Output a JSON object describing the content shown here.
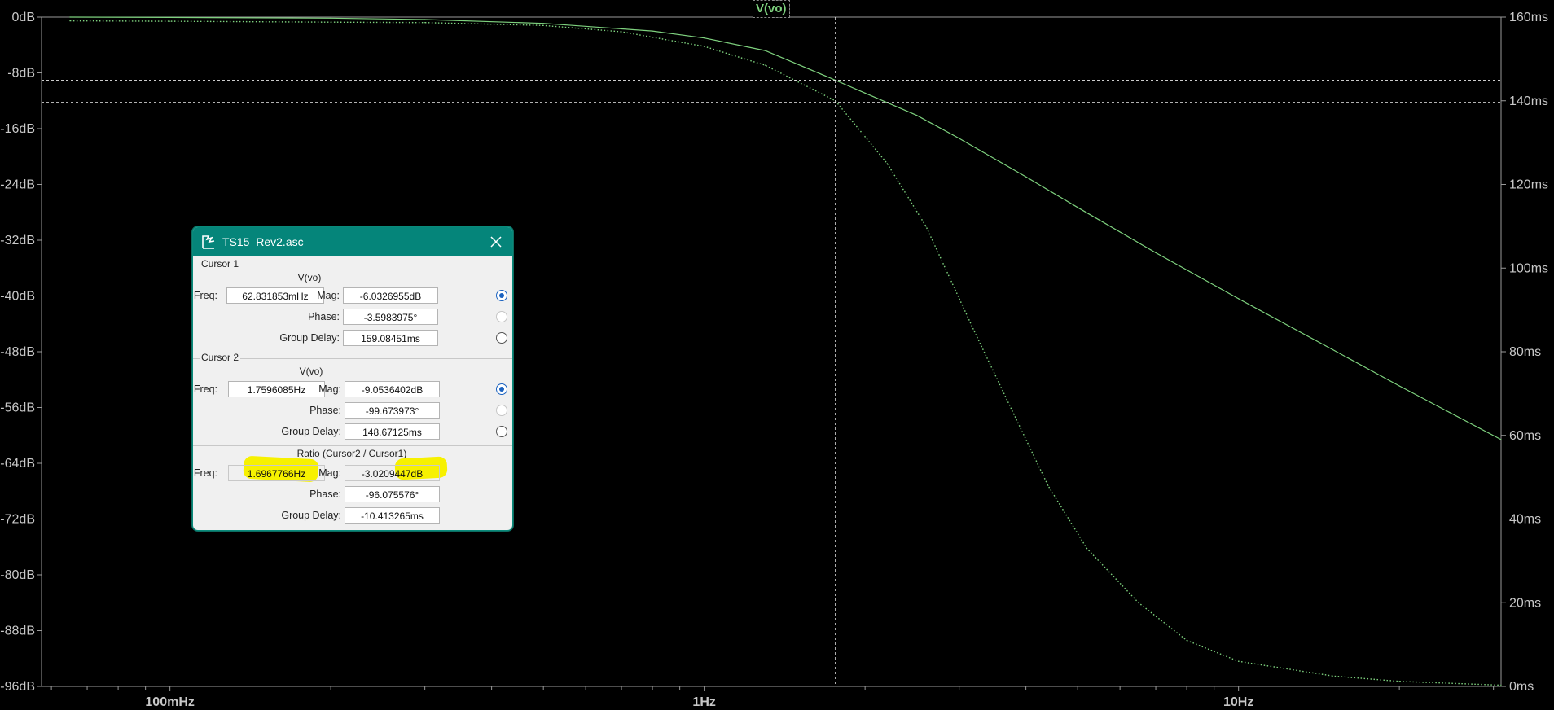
{
  "chart_data": {
    "type": "line",
    "title": "",
    "trace_label": "V(vo)",
    "x_scale": "log",
    "xlim_hz": [
      0.0575,
      31.0
    ],
    "x_ticks": [
      {
        "value": 0.1,
        "label": "100mHz"
      },
      {
        "value": 1,
        "label": "1Hz"
      },
      {
        "value": 10,
        "label": "10Hz"
      }
    ],
    "left_axis": {
      "unit": "dB",
      "ylim": [
        -96,
        0
      ],
      "ticks": [
        "0dB",
        "-8dB",
        "-16dB",
        "-24dB",
        "-32dB",
        "-40dB",
        "-48dB",
        "-56dB",
        "-64dB",
        "-72dB",
        "-80dB",
        "-88dB",
        "-96dB"
      ]
    },
    "right_axis": {
      "unit": "ms",
      "ylim": [
        0,
        160
      ],
      "ticks": [
        "160ms",
        "140ms",
        "120ms",
        "100ms",
        "80ms",
        "60ms",
        "40ms",
        "20ms",
        "0ms"
      ]
    },
    "cursor": {
      "freq_hz": 1.7596085,
      "mag_db": -9.0536402
    },
    "series": [
      {
        "role": "magnitude",
        "axis": "left",
        "style": "solid",
        "points": [
          [
            0.065,
            0
          ],
          [
            0.1,
            -0.05
          ],
          [
            0.2,
            -0.15
          ],
          [
            0.3,
            -0.35
          ],
          [
            0.5,
            -0.9
          ],
          [
            0.8,
            -2.0
          ],
          [
            1.0,
            -3.0
          ],
          [
            1.3,
            -4.8
          ],
          [
            1.7596,
            -9.05
          ],
          [
            2.0,
            -10.9
          ],
          [
            2.5,
            -14.1
          ],
          [
            3.0,
            -17.4
          ],
          [
            4.0,
            -22.9
          ],
          [
            5.0,
            -27.3
          ],
          [
            7.0,
            -33.8
          ],
          [
            10.0,
            -40.4
          ],
          [
            15.0,
            -47.7
          ],
          [
            20.0,
            -52.9
          ],
          [
            31.0,
            -60.6
          ]
        ]
      },
      {
        "role": "group_delay",
        "axis": "right",
        "style": "dotted",
        "points": [
          [
            0.065,
            159.1
          ],
          [
            0.1,
            159.0
          ],
          [
            0.2,
            158.8
          ],
          [
            0.3,
            158.7
          ],
          [
            0.5,
            158.0
          ],
          [
            0.7,
            156.5
          ],
          [
            1.0,
            153.0
          ],
          [
            1.3,
            148.5
          ],
          [
            1.7596,
            140.0
          ],
          [
            2.2,
            125.0
          ],
          [
            2.6,
            110.0
          ],
          [
            3.2,
            85.0
          ],
          [
            3.8,
            65.0
          ],
          [
            4.4,
            48.0
          ],
          [
            5.2,
            33.0
          ],
          [
            6.5,
            20.0
          ],
          [
            8.0,
            11.0
          ],
          [
            10.0,
            6.0
          ],
          [
            15.0,
            2.5
          ],
          [
            20.0,
            1.2
          ],
          [
            31.0,
            0.3
          ]
        ]
      }
    ],
    "colors": {
      "trace": "#7ed17e",
      "axis": "#9a9a9a",
      "background": "#000000",
      "cursor_line": "#ffffff"
    }
  },
  "dialog": {
    "title": "TS15_Rev2.asc",
    "cursor1": {
      "section_label": "Cursor 1",
      "expr": "V(vo)",
      "freq_label": "Freq:",
      "freq": "62.831853mHz",
      "mag_label": "Mag:",
      "mag": "-6.0326955dB",
      "phase_label": "Phase:",
      "phase": "-3.5983975°",
      "gd_label": "Group Delay:",
      "gd": "159.08451ms"
    },
    "cursor2": {
      "section_label": "Cursor 2",
      "expr": "V(vo)",
      "freq_label": "Freq:",
      "freq": "1.7596085Hz",
      "mag_label": "Mag:",
      "mag": "-9.0536402dB",
      "phase_label": "Phase:",
      "phase": "-99.673973°",
      "gd_label": "Group Delay:",
      "gd": "148.67125ms"
    },
    "ratio": {
      "section_label": "Ratio (Cursor2 / Cursor1)",
      "freq_label": "Freq:",
      "freq": "1.6967766Hz",
      "mag_label": "Mag:",
      "mag": "-3.0209447dB",
      "phase_label": "Phase:",
      "phase": "-96.075576°",
      "gd_label": "Group Delay:",
      "gd": "-10.413265ms"
    },
    "radio_states": {
      "c1_mag": true,
      "c1_phase": false,
      "c1_gd": false,
      "c2_mag": true,
      "c2_phase": false,
      "c2_gd": false
    },
    "accent_color": "#05857a",
    "highlight_color": "#f7f100"
  }
}
